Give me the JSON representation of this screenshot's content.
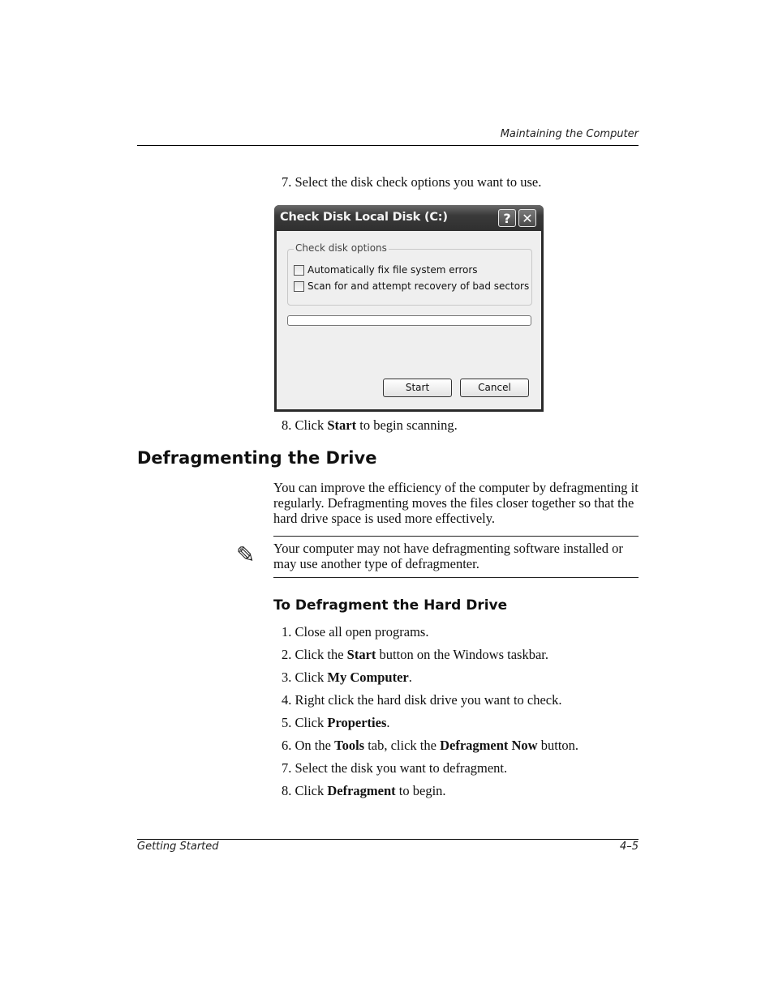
{
  "header": {
    "running_title": "Maintaining the Computer"
  },
  "steps_top": [
    {
      "number": "7.",
      "text": "Select the disk check options you want to use."
    },
    {
      "number": "8.",
      "pre": "Click ",
      "bold": "Start",
      "post": " to begin scanning."
    }
  ],
  "dialog": {
    "title": "Check Disk Local Disk (C:)",
    "help_glyph": "?",
    "close_glyph": "✕",
    "group_label": "Check disk options",
    "options": [
      {
        "label": "Automatically fix file system errors",
        "checked": false
      },
      {
        "label": "Scan for and attempt recovery of bad sectors",
        "checked": false
      }
    ],
    "progress": 0,
    "start_label": "Start",
    "cancel_label": "Cancel"
  },
  "section": {
    "heading": "Defragmenting the Drive",
    "paragraph": "You can improve the efficiency of the computer by defragmenting it regularly. Defragmenting moves the files closer together so that the hard drive space is used more effectively.",
    "note_icon": "✎",
    "note": "Your computer may not have defragmenting software installed or may use another type of defragmenter.",
    "subheading": "To Defragment the Hard Drive",
    "steps": [
      {
        "number": "1.",
        "pre": "Close all open programs.",
        "bold": "",
        "post": ""
      },
      {
        "number": "2.",
        "pre": "Click the ",
        "bold": "Start",
        "post": " button on the Windows taskbar."
      },
      {
        "number": "3.",
        "pre": "Click ",
        "bold": "My Computer",
        "post": "."
      },
      {
        "number": "4.",
        "pre": "Right click the hard disk drive you want to check.",
        "bold": "",
        "post": ""
      },
      {
        "number": "5.",
        "pre": "Click ",
        "bold": "Properties",
        "post": "."
      },
      {
        "number": "6.",
        "pre": "On the ",
        "bold": "Tools",
        "mid": " tab, click the ",
        "bold2": "Defragment Now",
        "post": " button."
      },
      {
        "number": "7.",
        "pre": "Select the disk you want to defragment.",
        "bold": "",
        "post": ""
      },
      {
        "number": "8.",
        "pre": "Click ",
        "bold": "Defragment",
        "post": " to begin."
      }
    ]
  },
  "footer": {
    "left": "Getting Started",
    "right": "4–5"
  }
}
